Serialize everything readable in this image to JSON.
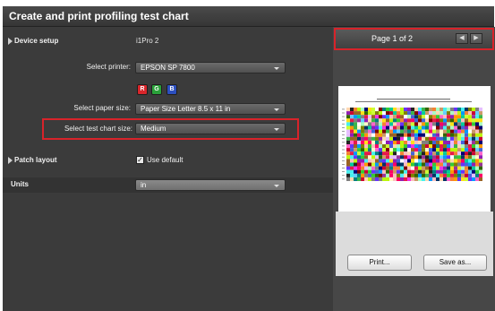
{
  "window": {
    "title": "Create and print profiling test chart"
  },
  "sections": {
    "device_setup": {
      "label": "Device setup",
      "value": "i1Pro 2"
    },
    "patch_layout": {
      "label": "Patch layout"
    }
  },
  "form": {
    "printer": {
      "label": "Select printer:",
      "value": "EPSON SP 7800"
    },
    "channels": [
      "R",
      "G",
      "B"
    ],
    "paper_size": {
      "label": "Select paper size:",
      "value": "Paper Size Letter  8.5 x 11 in"
    },
    "test_chart_size": {
      "label": "Select test chart size:",
      "value": "Medium"
    },
    "use_default": {
      "label": "Use default",
      "checked": true
    },
    "units": {
      "label": "Units",
      "value": "in"
    }
  },
  "preview": {
    "page_indicator": "Page 1 of 2",
    "prev_icon": "chevron-left-icon",
    "next_icon": "chevron-right-icon"
  },
  "buttons": {
    "print": "Print...",
    "save_as": "Save as..."
  },
  "colors": {
    "highlight": "#d8232a",
    "r_button": "#d9262b",
    "g_button": "#2aa13a",
    "b_button": "#2c4fbf",
    "panel_dark": "#3b3b3b"
  }
}
